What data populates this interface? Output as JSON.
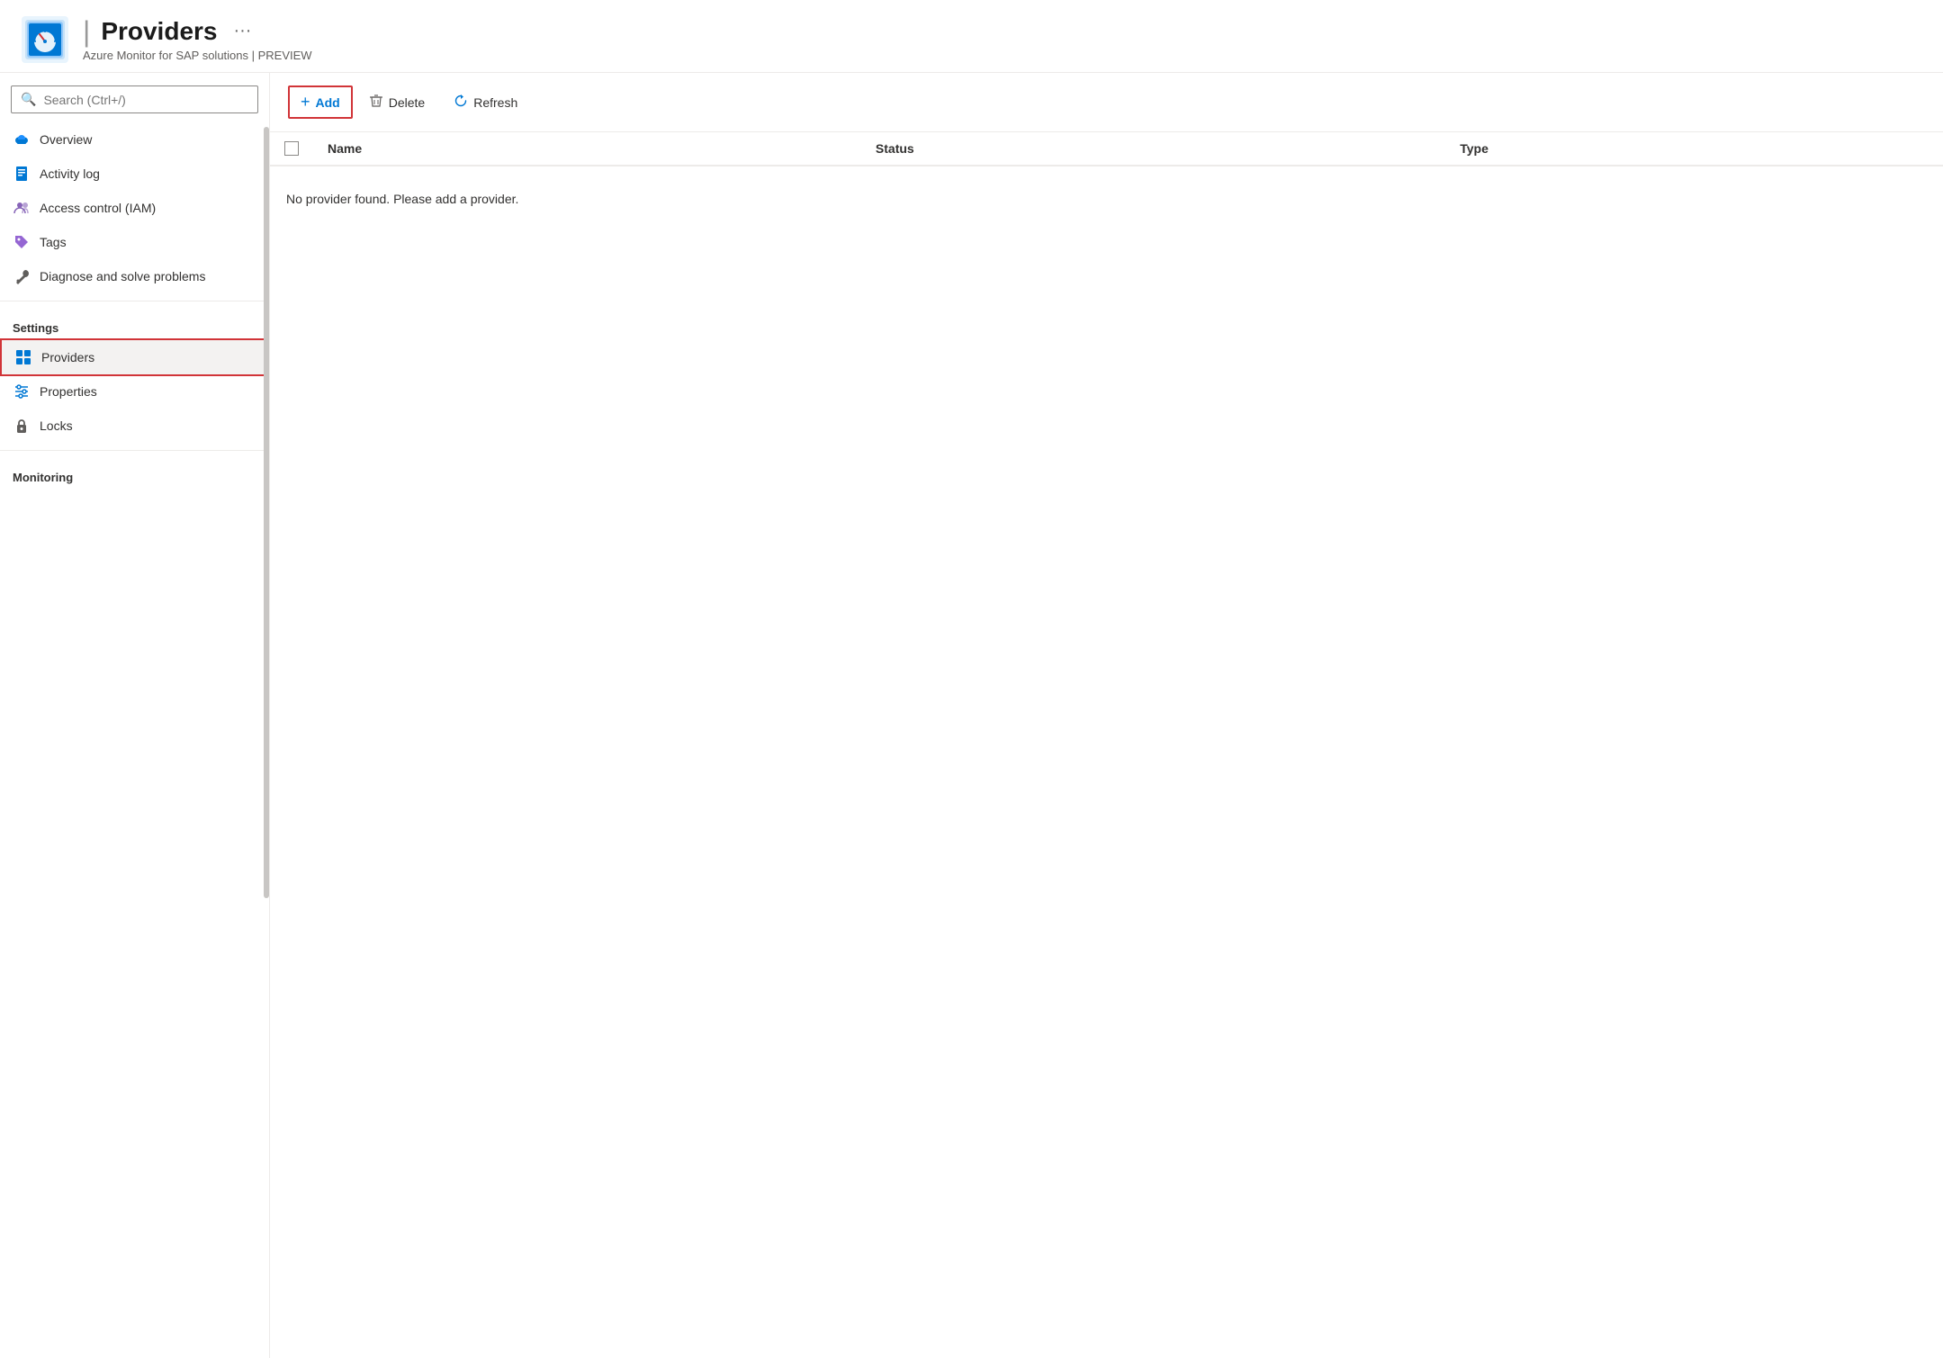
{
  "header": {
    "title": "Providers",
    "subtitle": "Azure Monitor for SAP solutions | PREVIEW",
    "pipe": "|",
    "ellipsis": "···"
  },
  "search": {
    "placeholder": "Search (Ctrl+/)"
  },
  "nav": {
    "items": [
      {
        "id": "overview",
        "label": "Overview",
        "icon": "cloud"
      },
      {
        "id": "activity-log",
        "label": "Activity log",
        "icon": "doc"
      },
      {
        "id": "access-control",
        "label": "Access control (IAM)",
        "icon": "person"
      },
      {
        "id": "tags",
        "label": "Tags",
        "icon": "tag"
      },
      {
        "id": "diagnose",
        "label": "Diagnose and solve problems",
        "icon": "wrench"
      }
    ],
    "sections": [
      {
        "label": "Settings",
        "items": [
          {
            "id": "providers",
            "label": "Providers",
            "icon": "grid",
            "active": true
          },
          {
            "id": "properties",
            "label": "Properties",
            "icon": "sliders"
          },
          {
            "id": "locks",
            "label": "Locks",
            "icon": "lock"
          }
        ]
      },
      {
        "label": "Monitoring",
        "items": []
      }
    ]
  },
  "toolbar": {
    "add_label": "Add",
    "delete_label": "Delete",
    "refresh_label": "Refresh"
  },
  "table": {
    "columns": [
      "Name",
      "Status",
      "Type"
    ],
    "empty_message": "No provider found. Please add a provider."
  }
}
